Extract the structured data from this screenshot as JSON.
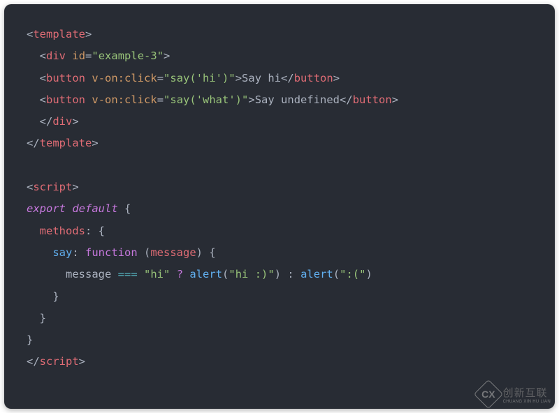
{
  "code": {
    "template_open": "template",
    "div_open_tag": "div",
    "div_id_attr": "id",
    "div_id_val": "\"example-3\"",
    "button_tag": "button",
    "von_attr": "v-on:click",
    "btn1_val": "\"say('hi')\"",
    "btn1_text": "Say hi",
    "btn2_val": "\"say('what')\"",
    "btn2_text": "Say undefined",
    "div_close": "div",
    "template_close": "template",
    "script_open": "script",
    "export_kw": "export",
    "default_kw": "default",
    "methods_prop": "methods",
    "say_prop": "say",
    "function_kw": "function",
    "message_param": "message",
    "message_var": "message",
    "eq_op": "===",
    "hi_str": "\"hi\"",
    "qmark": "?",
    "alert_fn": "alert",
    "hi_smile": "\"hi :)\"",
    "colon_op": ":",
    "sad_str": "\":(\"",
    "script_close": "script"
  },
  "watermark": {
    "logo_text": "CX",
    "cn": "创新互联",
    "en": "CHUANG XIN HU LIAN"
  }
}
